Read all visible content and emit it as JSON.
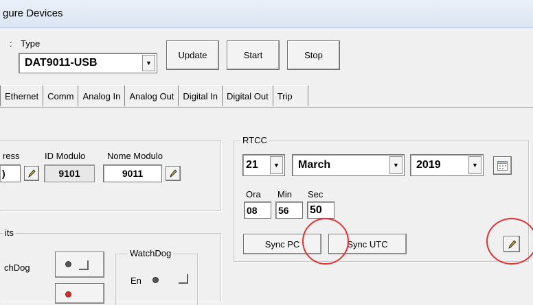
{
  "window": {
    "title": "gure Devices"
  },
  "toolbar": {
    "colon_label": ":",
    "type_label": "Type",
    "type_value": "DAT9011-USB",
    "update_label": "Update",
    "start_label": "Start",
    "stop_label": "Stop"
  },
  "tabs": [
    "Ethernet",
    "Comm",
    "Analog In",
    "Analog Out",
    "Digital In",
    "Digital Out",
    "Trip"
  ],
  "device": {
    "address_label": "ress",
    "address_value": ")",
    "id_modulo_label": "ID Modulo",
    "id_modulo_value": "9101",
    "nome_modulo_label": "Nome Modulo",
    "nome_modulo_value": "9011"
  },
  "outputs": {
    "group_label": "its",
    "watchdog_partial_label": "chDog",
    "watchdog_group_label": "WatchDog",
    "en_label": "En"
  },
  "rtcc": {
    "group_label": "RTCC",
    "day": "21",
    "month": "March",
    "year": "2019",
    "ora_label": "Ora",
    "min_label": "Min",
    "sec_label": "Sec",
    "ora_value": "08",
    "min_value": "56",
    "sec_value": "50",
    "sync_pc_label": "Sync PC",
    "sync_utc_label": "Sync UTC"
  },
  "colors": {
    "annotation_circle": "#e03030",
    "titlebar": "#dbe6f3"
  },
  "icons": {
    "edit": "pencil-icon",
    "calendar": "calendar-icon",
    "dropdown": "chevron-down-icon"
  }
}
